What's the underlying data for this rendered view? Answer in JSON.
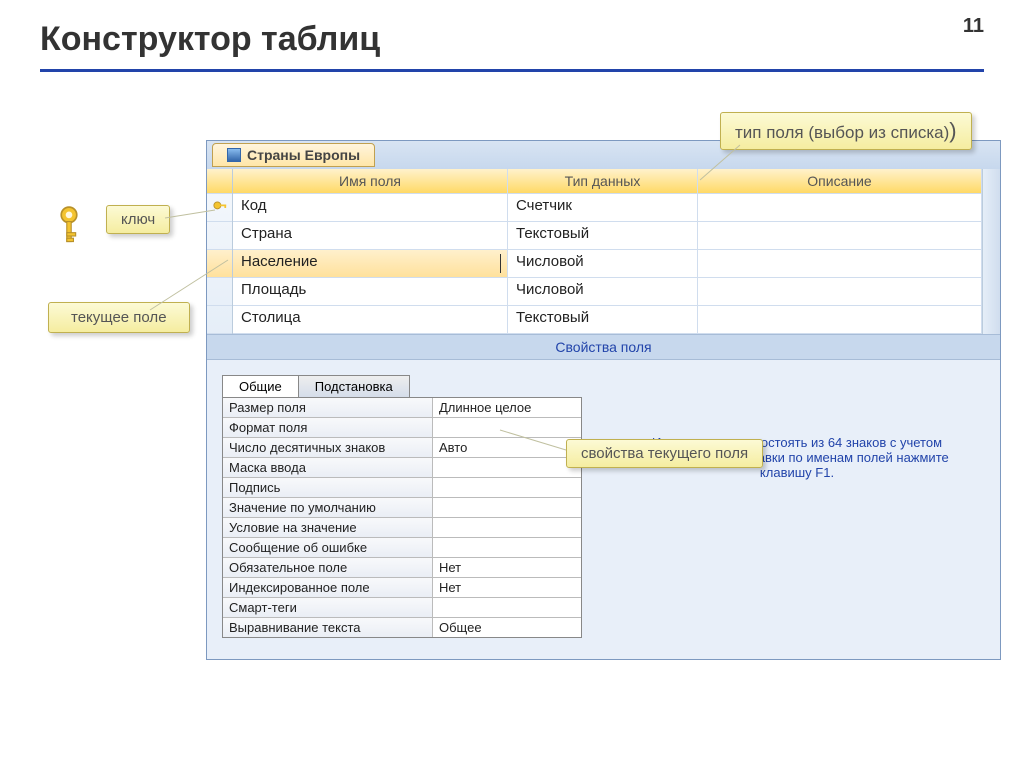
{
  "slide": {
    "title": "Конструктор таблиц",
    "number": "11"
  },
  "window": {
    "tab_title": "Страны Европы",
    "columns": {
      "name": "Имя поля",
      "type": "Тип данных",
      "desc": "Описание"
    },
    "rows": [
      {
        "name": "Код",
        "type": "Счетчик",
        "desc": "",
        "key": true
      },
      {
        "name": "Страна",
        "type": "Текстовый",
        "desc": ""
      },
      {
        "name": "Население",
        "type": "Числовой",
        "desc": "",
        "current": true
      },
      {
        "name": "Площадь",
        "type": "Числовой",
        "desc": ""
      },
      {
        "name": "Столица",
        "type": "Текстовый",
        "desc": ""
      }
    ],
    "props_title": "Свойства поля",
    "prop_tabs": {
      "general": "Общие",
      "lookup": "Подстановка"
    },
    "properties": [
      {
        "label": "Размер поля",
        "value": "Длинное целое"
      },
      {
        "label": "Формат поля",
        "value": ""
      },
      {
        "label": "Число десятичных знаков",
        "value": "Авто"
      },
      {
        "label": "Маска ввода",
        "value": ""
      },
      {
        "label": "Подпись",
        "value": ""
      },
      {
        "label": "Значение по умолчанию",
        "value": ""
      },
      {
        "label": "Условие на значение",
        "value": ""
      },
      {
        "label": "Сообщение об ошибке",
        "value": ""
      },
      {
        "label": "Обязательное поле",
        "value": "Нет"
      },
      {
        "label": "Индексированное поле",
        "value": "Нет"
      },
      {
        "label": "Смарт-теги",
        "value": ""
      },
      {
        "label": "Выравнивание текста",
        "value": "Общее"
      }
    ],
    "help_text": "Имя поля может состоять из 64 знаков с учетом пробелов. Для справки по именам полей нажмите клавишу F1."
  },
  "callouts": {
    "field_type": "тип поля (выбор из списка)",
    "key": "ключ",
    "current_field": "текущее поле",
    "current_props": "свойства текущего поля"
  }
}
